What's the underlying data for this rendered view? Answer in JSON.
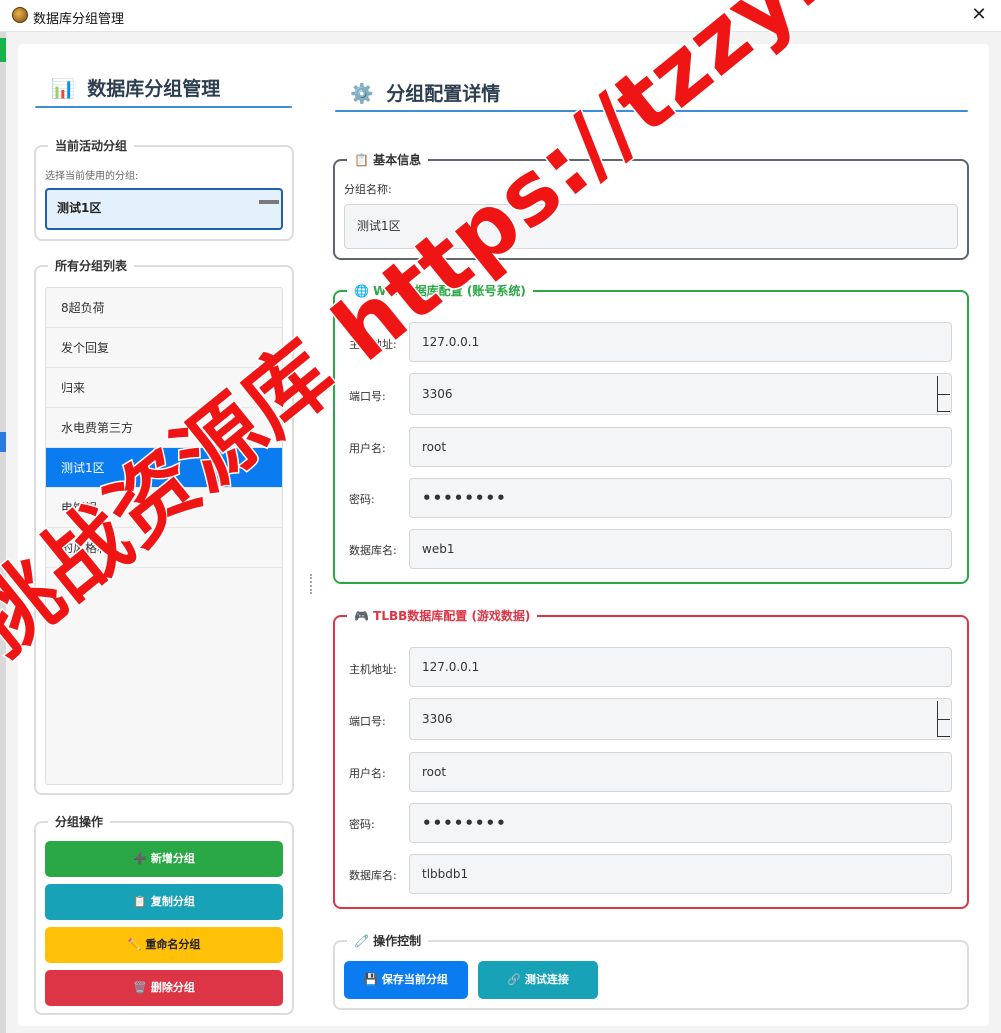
{
  "window": {
    "title": "数据库分组管理",
    "close_glyph": "✕"
  },
  "left": {
    "heading_icon": "📊",
    "heading": "数据库分组管理",
    "active_group": {
      "legend": "当前活动分组",
      "hint": "选择当前使用的分组:",
      "selected": "测试1区"
    },
    "all_groups": {
      "legend": "所有分组列表",
      "items": [
        {
          "label": "8超负荷",
          "selected": false
        },
        {
          "label": "发个回复",
          "selected": false
        },
        {
          "label": "归来",
          "selected": false
        },
        {
          "label": "水电费第三方",
          "selected": false
        },
        {
          "label": "测试1区",
          "selected": true
        },
        {
          "label": "电饭锅",
          "selected": false
        },
        {
          "label": "的风格和",
          "selected": false
        }
      ]
    },
    "operations": {
      "legend": "分组操作",
      "new": {
        "icon": "➕",
        "label": "新增分组",
        "color": "#2aa845"
      },
      "copy": {
        "icon": "📋",
        "label": "复制分组",
        "color": "#17a2b8"
      },
      "rename": {
        "icon": "✏️",
        "label": "重命名分组",
        "color": "#ffc107"
      },
      "delete": {
        "icon": "🗑️",
        "label": "删除分组",
        "color": "#dc3545"
      }
    }
  },
  "right": {
    "heading_icon": "⚙️",
    "heading": "分组配置详情",
    "basic": {
      "legend_icon": "📋",
      "legend": "基本信息",
      "name_label": "分组名称:",
      "name_value": "测试1区"
    },
    "web": {
      "legend_icon": "🌐",
      "legend": "Web数据库配置 (账号系统)",
      "color": "#2aa845",
      "host_label": "主机地址:",
      "host": "127.0.0.1",
      "port_label": "端口号:",
      "port": "3306",
      "user_label": "用户名:",
      "user": "root",
      "password_label": "密码:",
      "password": "••••••••",
      "db_label": "数据库名:",
      "db": "web1"
    },
    "tlbb": {
      "legend_icon": "🎮",
      "legend": "TLBB数据库配置 (游戏数据)",
      "color": "#dc3545",
      "host_label": "主机地址:",
      "host": "127.0.0.1",
      "port_label": "端口号:",
      "port": "3306",
      "user_label": "用户名:",
      "user": "root",
      "password_label": "密码:",
      "password": "••••••••",
      "db_label": "数据库名:",
      "db": "tlbbdb1"
    },
    "controls": {
      "legend_icon": "🧷",
      "legend": "操作控制",
      "save": {
        "icon": "💾",
        "label": "保存当前分组",
        "color": "#0a7cf0"
      },
      "test": {
        "icon": "🔗",
        "label": "测试连接",
        "color": "#17a2b8"
      }
    }
  },
  "watermark": "挑战资源库 https://tzzyk.com"
}
